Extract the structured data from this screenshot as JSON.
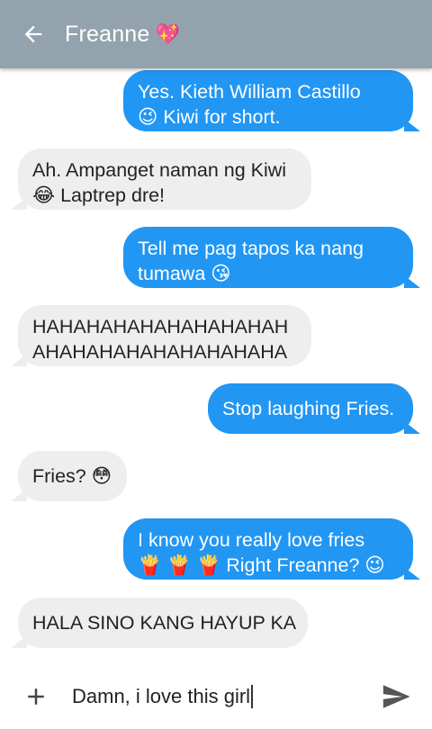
{
  "header": {
    "contact_name": "Freanne",
    "contact_emoji": "💖"
  },
  "messages": [
    {
      "direction": "out",
      "lines": [
        "Yes. Kieth William Castillo",
        "😉  Kiwi for short."
      ]
    },
    {
      "direction": "in",
      "lines": [
        "Ah. Ampanget naman ng Kiwi",
        "😂  Laptrep dre!"
      ]
    },
    {
      "direction": "out",
      "lines": [
        "Tell me pag tapos ka nang",
        "tumawa 😘"
      ]
    },
    {
      "direction": "in",
      "lines": [
        "HAHAHAHAHAHAHAHAHAH",
        "AHAHAHAHAHAHAHAHAHA"
      ]
    },
    {
      "direction": "out",
      "lines": [
        "Stop laughing Fries."
      ]
    },
    {
      "direction": "in",
      "lines": [
        "Fries? 😳"
      ]
    },
    {
      "direction": "out",
      "lines": [
        "I know you really love fries",
        "🍟 🍟 🍟  Right Freanne? 😉"
      ]
    },
    {
      "direction": "in",
      "lines": [
        "HALA SINO KANG HAYUP KA"
      ]
    }
  ],
  "composer": {
    "text": "Damn, i love this girl"
  },
  "colors": {
    "header_bg": "#93a3ad",
    "outgoing_bubble": "#2196f3",
    "incoming_bubble": "#eeeeee"
  },
  "icons": {
    "back": "arrow-left-icon",
    "add": "plus-icon",
    "send": "send-icon"
  }
}
